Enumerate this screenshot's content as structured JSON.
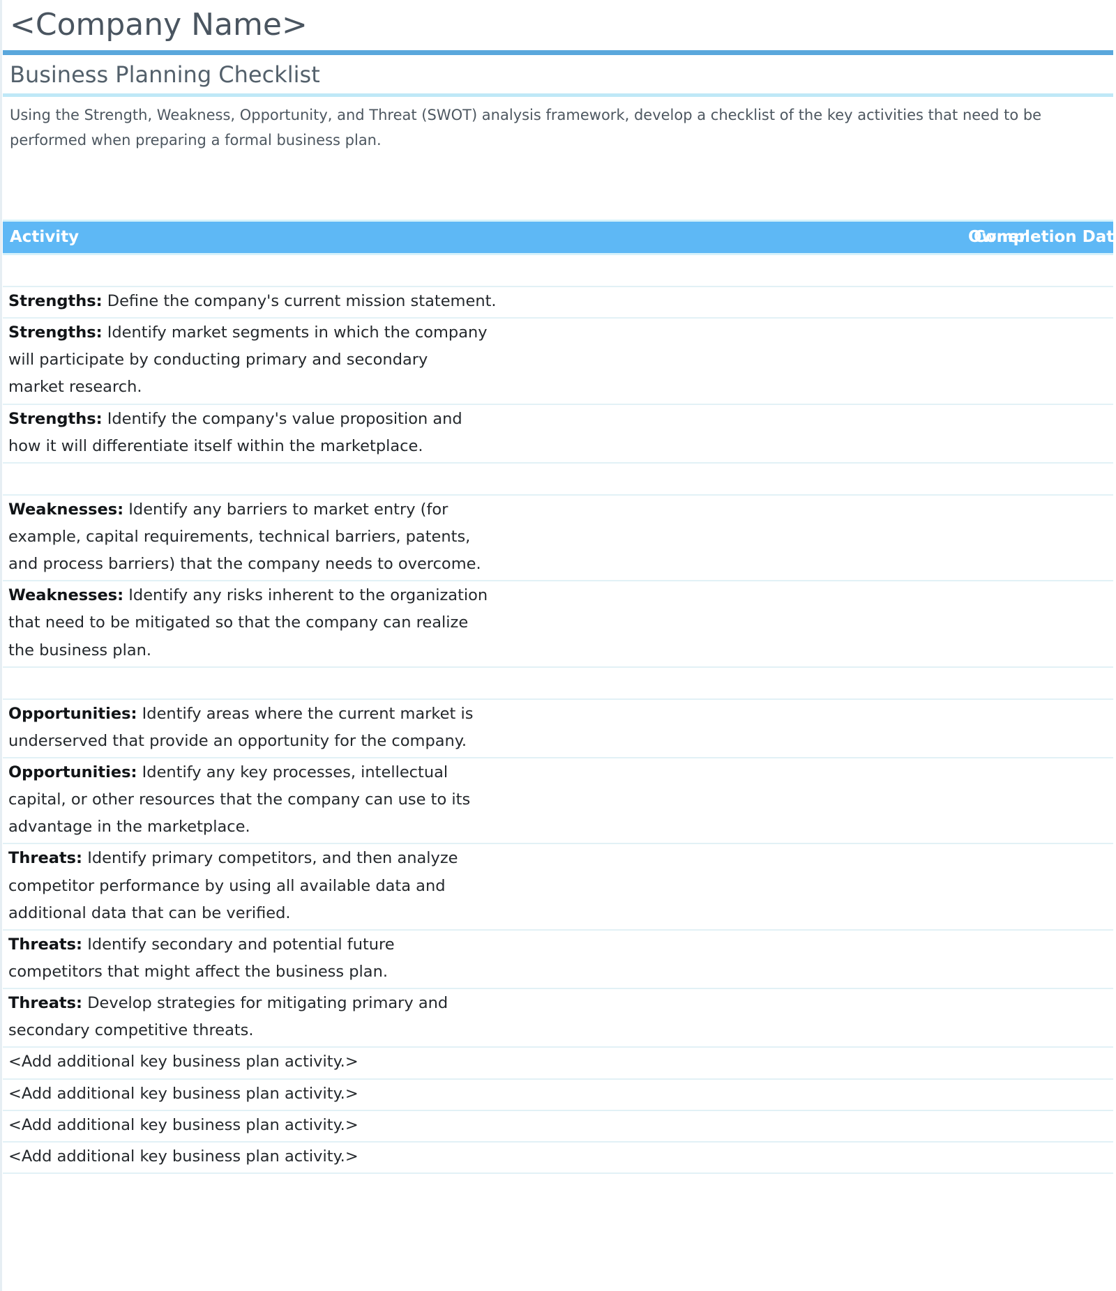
{
  "header": {
    "company_name": "<Company Name>",
    "document_title": "Business Planning Checklist",
    "intro": "Using the Strength, Weakness, Opportunity, and Threat (SWOT) analysis framework, develop a checklist of the key activities that need to be performed when preparing a formal business plan."
  },
  "colors": {
    "accent_rule_dark": "#5aa7dc",
    "accent_rule_light": "#bfe8f7",
    "table_header_bg": "#5eb8f5",
    "table_header_text": "#ffffff",
    "row_divider": "#e2f1f6",
    "title_text": "#4a5560"
  },
  "table": {
    "columns": [
      {
        "key": "activity",
        "label": "Activity"
      },
      {
        "key": "owner",
        "label": "Owner"
      },
      {
        "key": "completion_date",
        "label": "Completion Date"
      }
    ],
    "rows": [
      {
        "type": "blank",
        "label": "",
        "text": "",
        "owner": "",
        "completion_date": ""
      },
      {
        "type": "item",
        "label": "Strengths:",
        "text": " Define the company's current mission statement.",
        "owner": "",
        "completion_date": ""
      },
      {
        "type": "item",
        "label": "Strengths:",
        "text": " Identify market segments in which the company\nwill participate by conducting primary and secondary\nmarket research.",
        "owner": "",
        "completion_date": ""
      },
      {
        "type": "item",
        "label": "Strengths:",
        "text": " Identify the company's value proposition and\nhow it will differentiate itself within the marketplace.",
        "owner": "",
        "completion_date": ""
      },
      {
        "type": "blank",
        "label": "",
        "text": "",
        "owner": "",
        "completion_date": ""
      },
      {
        "type": "item",
        "label": "Weaknesses:",
        "text": " Identify any barriers to market entry (for\nexample, capital requirements, technical barriers, patents,\nand process barriers) that the company needs to overcome.",
        "owner": "",
        "completion_date": ""
      },
      {
        "type": "item",
        "label": "Weaknesses:",
        "text": " Identify any risks inherent to the organization\nthat need to be mitigated so that the company can realize\nthe business plan.",
        "owner": "",
        "completion_date": ""
      },
      {
        "type": "blank",
        "label": "",
        "text": "",
        "owner": "",
        "completion_date": ""
      },
      {
        "type": "item",
        "label": "Opportunities:",
        "text": " Identify areas where the current market is\nunderserved that provide an opportunity for the company.",
        "owner": "",
        "completion_date": ""
      },
      {
        "type": "item",
        "label": "Opportunities:",
        "text": " Identify any key processes, intellectual\ncapital, or other resources that the company can use to its\nadvantage in the marketplace.",
        "owner": "",
        "completion_date": ""
      },
      {
        "type": "item",
        "label": "Threats:",
        "text": " Identify primary competitors, and then analyze\ncompetitor performance by using all available data and\nadditional data that can be verified.",
        "owner": "",
        "completion_date": ""
      },
      {
        "type": "item",
        "label": "Threats:",
        "text": " Identify secondary and potential future\ncompetitors that might affect the business plan.",
        "owner": "",
        "completion_date": ""
      },
      {
        "type": "item",
        "label": "Threats:",
        "text": " Develop strategies for mitigating primary and\nsecondary competitive threats.",
        "owner": "",
        "completion_date": ""
      },
      {
        "type": "placeholder",
        "label": "",
        "text": "<Add additional key business plan activity.>",
        "owner": "",
        "completion_date": ""
      },
      {
        "type": "placeholder",
        "label": "",
        "text": "<Add additional key business plan activity.>",
        "owner": "",
        "completion_date": ""
      },
      {
        "type": "placeholder",
        "label": "",
        "text": "<Add additional key business plan activity.>",
        "owner": "",
        "completion_date": ""
      },
      {
        "type": "placeholder",
        "label": "",
        "text": "<Add additional key business plan activity.>",
        "owner": "",
        "completion_date": ""
      }
    ]
  }
}
